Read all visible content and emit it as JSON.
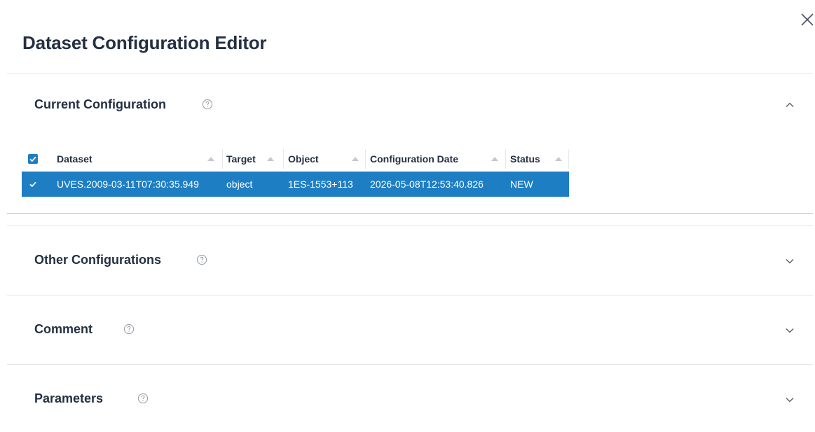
{
  "dialog": {
    "title": "Dataset Configuration Editor"
  },
  "sections": {
    "current": {
      "title": "Current Configuration",
      "expanded": true
    },
    "other": {
      "title": "Other Configurations",
      "expanded": false
    },
    "comment": {
      "title": "Comment",
      "expanded": false
    },
    "parameters": {
      "title": "Parameters",
      "expanded": false
    }
  },
  "table": {
    "columns": {
      "dataset": "Dataset",
      "target": "Target",
      "object": "Object",
      "configuration_date": "Configuration Date",
      "status": "Status"
    },
    "rows": [
      {
        "selected": true,
        "dataset": "UVES.2009-03-11T07:30:35.949",
        "target": "object",
        "object": "1ES-1553+113",
        "configuration_date": "2026-05-08T12:53:40.826",
        "status": "NEW"
      }
    ]
  },
  "colors": {
    "accent": "#1e7ec3",
    "title_text": "#243042",
    "divider": "#e3e6ea"
  },
  "icons": {
    "close": "close-icon",
    "help": "help-circle-icon",
    "expand": "chevron-down-icon",
    "collapse": "chevron-up-icon",
    "sort": "sort-ascending-icon",
    "checkbox": "checkbox-checked-icon"
  }
}
